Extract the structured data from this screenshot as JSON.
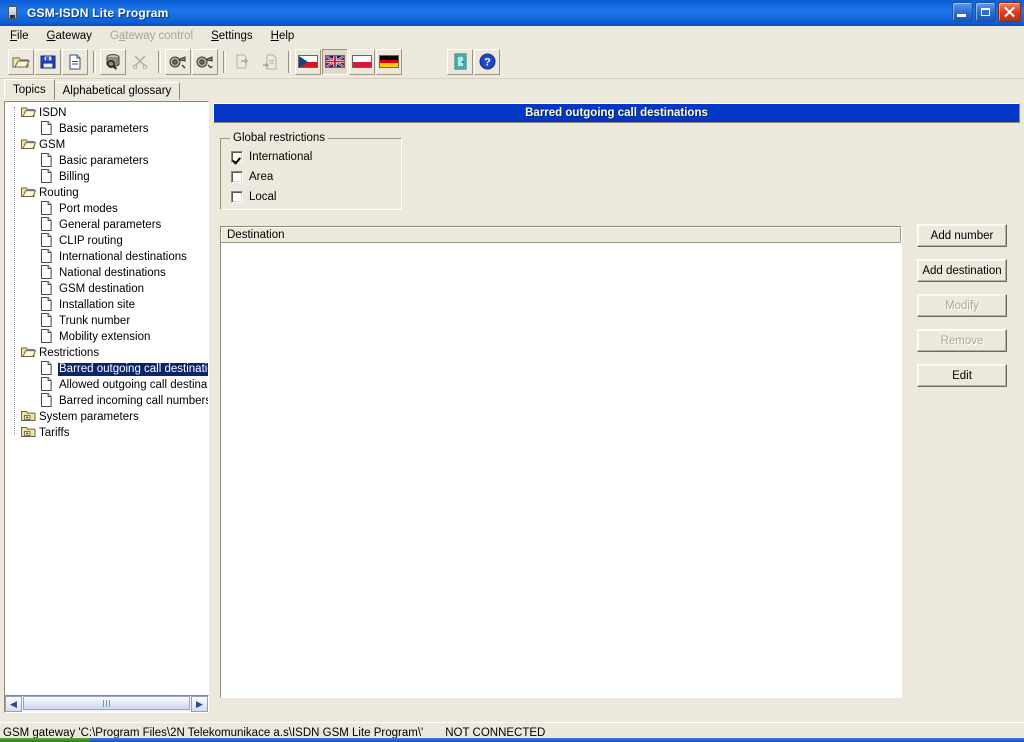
{
  "window": {
    "title": "GSM-ISDN Lite Program",
    "icon": "app-window-icon",
    "minimize_label": "Minimize",
    "restore_label": "Restore",
    "close_label": "Close"
  },
  "colors": {
    "titlebar_blue": "#0d62d9",
    "content_header_blue": "#0537c7",
    "face": "#ece9dc",
    "selection_blue": "#0a246a",
    "header_text": "#ffffcc",
    "disabled_text": "#a8a496"
  },
  "menu": [
    {
      "label": "File",
      "accel": "F",
      "enabled": true
    },
    {
      "label": "Gateway",
      "accel": "G",
      "enabled": true
    },
    {
      "label": "Gateway control",
      "accel": "a",
      "enabled": false
    },
    {
      "label": "Settings",
      "accel": "S",
      "enabled": true
    },
    {
      "label": "Help",
      "accel": "H",
      "enabled": true
    }
  ],
  "toolbar": {
    "buttons": [
      {
        "name": "open-icon",
        "tip": "Open",
        "enabled": true
      },
      {
        "name": "save-icon",
        "tip": "Save",
        "enabled": true
      },
      {
        "name": "new-document-icon",
        "tip": "New",
        "enabled": true
      },
      {
        "name": "read-from-gateway-icon",
        "tip": "Read from gateway",
        "enabled": true
      },
      {
        "name": "disconnect-icon",
        "tip": "Disconnect",
        "enabled": false
      },
      {
        "name": "connect-modem-icon",
        "tip": "Connect",
        "enabled": true
      },
      {
        "name": "modem-settings-icon",
        "tip": "Modem settings",
        "enabled": true
      },
      {
        "name": "send-to-gateway-icon",
        "tip": "Send to gateway",
        "enabled": false
      },
      {
        "name": "export-document-icon",
        "tip": "Export",
        "enabled": false
      }
    ],
    "languages": [
      {
        "name": "flag-czech-icon",
        "label": "Czech",
        "selected": false
      },
      {
        "name": "flag-uk-icon",
        "label": "English",
        "selected": true
      },
      {
        "name": "flag-poland-icon",
        "label": "Polish",
        "selected": false
      },
      {
        "name": "flag-germany-icon",
        "label": "German",
        "selected": false
      }
    ],
    "right_buttons": [
      {
        "name": "exit-door-icon",
        "tip": "Exit",
        "enabled": true
      },
      {
        "name": "help-question-icon",
        "tip": "Help",
        "enabled": true
      }
    ]
  },
  "tabs": [
    {
      "label": "Topics",
      "active": true
    },
    {
      "label": "Alphabetical glossary",
      "active": false
    }
  ],
  "tree": [
    {
      "label": "ISDN",
      "type": "folder-open",
      "level": 0,
      "selected": false
    },
    {
      "label": "Basic parameters",
      "type": "document",
      "level": 1,
      "selected": false
    },
    {
      "label": "GSM",
      "type": "folder-open",
      "level": 0,
      "selected": false
    },
    {
      "label": "Basic parameters",
      "type": "document",
      "level": 1,
      "selected": false
    },
    {
      "label": "Billing",
      "type": "document",
      "level": 1,
      "selected": false
    },
    {
      "label": "Routing",
      "type": "folder-open",
      "level": 0,
      "selected": false
    },
    {
      "label": "Port modes",
      "type": "document",
      "level": 1,
      "selected": false
    },
    {
      "label": "General parameters",
      "type": "document",
      "level": 1,
      "selected": false
    },
    {
      "label": "CLIP routing",
      "type": "document",
      "level": 1,
      "selected": false
    },
    {
      "label": "International destinations",
      "type": "document",
      "level": 1,
      "selected": false
    },
    {
      "label": "National destinations",
      "type": "document",
      "level": 1,
      "selected": false
    },
    {
      "label": "GSM destination",
      "type": "document",
      "level": 1,
      "selected": false
    },
    {
      "label": "Installation site",
      "type": "document",
      "level": 1,
      "selected": false
    },
    {
      "label": "Trunk number",
      "type": "document",
      "level": 1,
      "selected": false
    },
    {
      "label": "Mobility extension",
      "type": "document",
      "level": 1,
      "selected": false
    },
    {
      "label": "Restrictions",
      "type": "folder-open",
      "level": 0,
      "selected": false
    },
    {
      "label": "Barred outgoing call destinatio",
      "type": "document",
      "level": 1,
      "selected": true
    },
    {
      "label": "Allowed outgoing call destina",
      "type": "document",
      "level": 1,
      "selected": false
    },
    {
      "label": "Barred incoming call numbers",
      "type": "document",
      "level": 1,
      "selected": false
    },
    {
      "label": "System parameters",
      "type": "folder-closed",
      "level": 0,
      "selected": false
    },
    {
      "label": "Tariffs",
      "type": "folder-closed",
      "level": 0,
      "selected": false
    }
  ],
  "main": {
    "header_title": "Barred outgoing call destinations",
    "group": {
      "title": "Global restrictions",
      "checkboxes": [
        {
          "label": "International",
          "checked": true
        },
        {
          "label": "Area",
          "checked": false
        },
        {
          "label": "Local",
          "checked": false
        }
      ]
    },
    "list": {
      "columns": [
        "Destination"
      ],
      "rows": []
    },
    "buttons": [
      {
        "label": "Add number",
        "enabled": true
      },
      {
        "label": "Add destination",
        "enabled": true
      },
      {
        "label": "Modify",
        "enabled": false
      },
      {
        "label": "Remove",
        "enabled": false
      },
      {
        "label": "Edit",
        "enabled": true
      }
    ]
  },
  "statusbar": {
    "gateway_path": "GSM gateway 'C:\\Program Files\\2N Telekomunikace a.s\\ISDN GSM Lite Program\\'",
    "connection": "NOT CONNECTED"
  }
}
